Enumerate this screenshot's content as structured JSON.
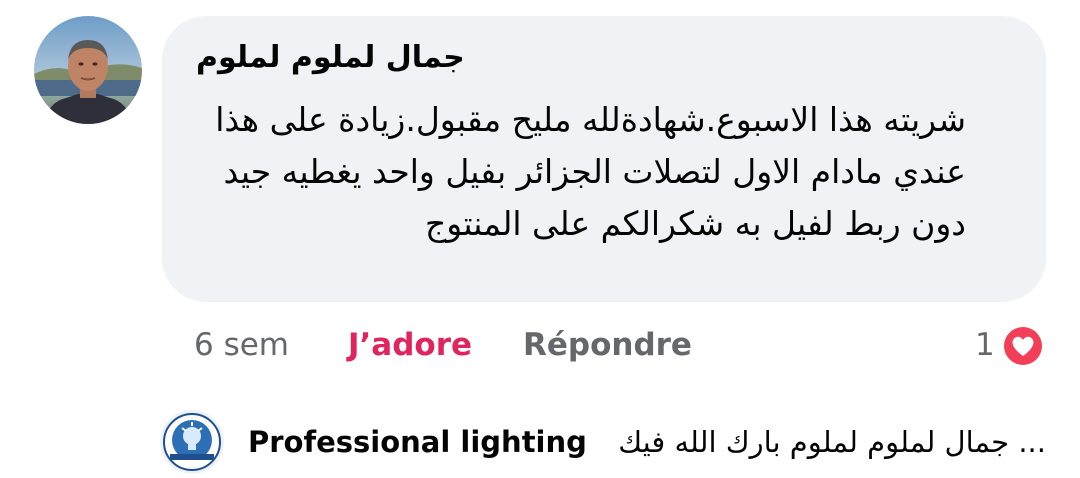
{
  "comment": {
    "author": "جمال لملوم لملوم",
    "text": "شريته هذا الاسبوع.شهادةلله مليح مقبول.زيادة على هذا عندي مادام الاول لتصلات الجزائر بفيل واحد يغطيه جيد دون ربط لفيل به شكرالكم على المنتوج",
    "avatar_icon": "user-photo"
  },
  "actions": {
    "time": "6 sem",
    "like_label": "J’adore",
    "reply_label": "Répondre",
    "reaction_count": "1",
    "reaction_icon": "love-heart-icon",
    "like_color": "#e0245e",
    "reaction_color": "#f33e58"
  },
  "reply_preview": {
    "author": "Professional lighting",
    "text": "جمال لملوم لملوم بارك الله فيك ...",
    "avatar_icon": "professional-lighting-logo"
  },
  "colors": {
    "bubble_background": "#f0f2f5",
    "text": "#050505",
    "secondary_text": "#65676b"
  }
}
